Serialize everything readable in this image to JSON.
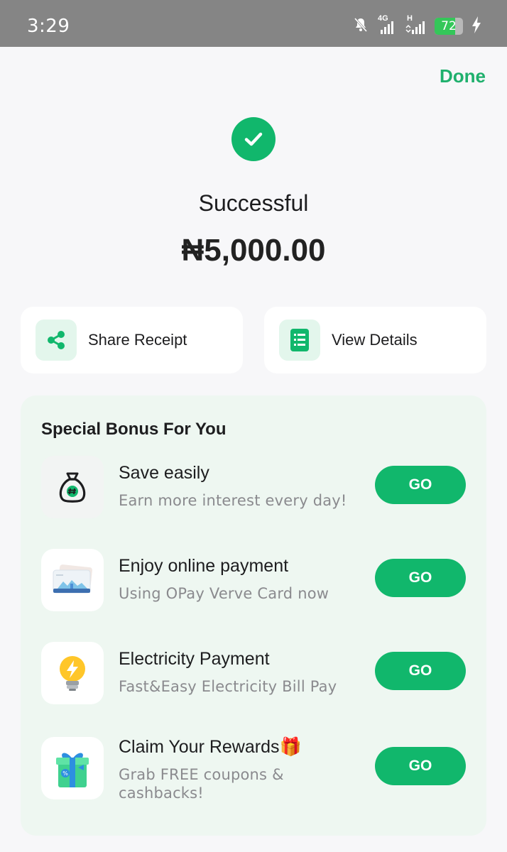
{
  "status_bar": {
    "time": "3:29",
    "battery_level": 72,
    "battery_text": "72",
    "network_1": "4G",
    "network_2": "H",
    "icons": [
      "bell-off-icon",
      "signal-4g-icon",
      "signal-h-icon",
      "battery-icon",
      "charging-icon"
    ]
  },
  "header": {
    "done_label": "Done"
  },
  "result": {
    "status": "Successful",
    "amount": "₦5,000.00",
    "icon": "check-circle-icon"
  },
  "actions": [
    {
      "label": "Share Receipt",
      "icon": "share-icon"
    },
    {
      "label": "View Details",
      "icon": "list-document-icon"
    }
  ],
  "bonus": {
    "title": "Special Bonus For You",
    "items": [
      {
        "name": "Save easily",
        "description": "Earn more interest every day!",
        "button": "GO",
        "icon": "money-bag-icon"
      },
      {
        "name": "Enjoy online payment",
        "description": "Using OPay Verve Card now",
        "button": "GO",
        "icon": "card-icon"
      },
      {
        "name": "Electricity Payment",
        "description": "Fast&Easy Electricity Bill Pay",
        "button": "GO",
        "icon": "light-bulb-icon"
      },
      {
        "name": "Claim Your Rewards🎁",
        "description": "Grab FREE coupons & cashbacks!",
        "button": "GO",
        "icon": "gift-box-icon"
      }
    ]
  },
  "colors": {
    "accent": "#11b76c",
    "done_text": "#1fb06d",
    "panel": "#eef7f1",
    "background": "#f7f7f9",
    "status_bar": "#858585"
  }
}
